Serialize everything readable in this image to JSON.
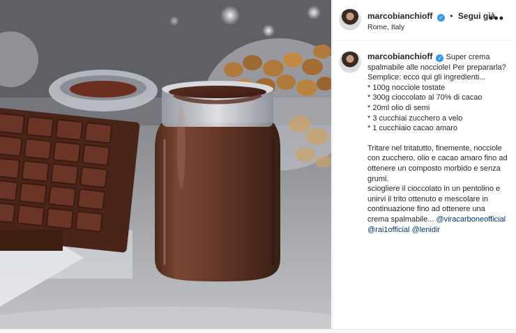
{
  "post": {
    "username": "marcobianchioff",
    "follow_label": "Segui già",
    "dot": "•",
    "location": "Rome, Italy",
    "more": "•••",
    "verified_glyph": "✓"
  },
  "caption": {
    "lines": [
      "Super crema",
      "spalmabile alle nocciole! Per prepararla?",
      "Semplice: ecco qui gli ingredienti...",
      "* 100g nocciole tostate",
      "* 300g cioccolato al 70% di cacao",
      "* 20ml olio di semi",
      "* 3 cucchiai zucchero a velo",
      "* 1 cucchiaio cacao amaro"
    ],
    "body_lines": [
      "Tritare nel tritatutto, finemente, nocciole",
      "con zucchero, olio e cacao amaro fino ad",
      "ottenere un composto morbido e senza",
      "grumi.",
      "sciogliere il cioccolato in un pentolino e",
      "unirvi il trito ottenuto e mescolare in",
      "continuazione fino ad ottenere una"
    ],
    "last_line_text": "crema spalmabile... ",
    "mention1": "@viracarboneofficial",
    "mention2": "@rai1official",
    "mention3": "@lenidir"
  },
  "colors": {
    "text": "#262626",
    "mention": "#00376b",
    "verified": "#3897f0",
    "divider": "#efefef"
  }
}
